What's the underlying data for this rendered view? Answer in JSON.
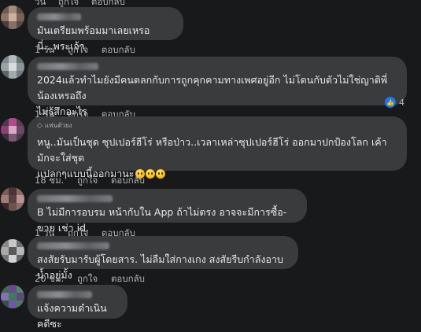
{
  "top_actions": {
    "time": "วัน",
    "like": "ถูกใจ",
    "reply": "ตอบกลับ"
  },
  "comments": [
    {
      "text": "มันเตรียมพร้อมมาเลยเหรอนี่...พระเจ้า",
      "time": "1 วัน",
      "like": "ถูกใจ",
      "reply": "ตอบกลับ"
    },
    {
      "text": "2024แล้วทำไมยังมีคนตลกกับการถูกคุกคามทางเพศอยู่อีก ไม่โดนกับตัวไม่ใช่ญาติพี่น้องเหรอถึง\nไม่รู้สึกอะไร",
      "time": "1 วัน",
      "like": "ถูกใจ",
      "reply": "ตอบกลับ",
      "reaction_count": "4"
    },
    {
      "badge": "แฟนตัวยง",
      "text": "หนู..มันเป็นชุด ซุปเปอร์ฮีโร่ หรือป่าว..เวลาเหล่าซุปเปอร์ฮีโร่ ออกมาปกป้องโลก เค้ามักจะใส่ชุด\nแปลกๆแบบนี้ออกมานะ",
      "time": "18 ชม.",
      "like": "ถูกใจ",
      "reply": "ตอบกลับ"
    },
    {
      "text": "B ไม่มีการอบรม หน้ากับใน App ถ้าไม่ตรง อาจจะมีการซื้อ-ขาย เช่า id.",
      "time": "1 วัน",
      "like": "ถูกใจ",
      "reply": "ตอบกลับ"
    },
    {
      "text": "สงสัยรับมารับผู้โดยสาร. ไม่ลืมใส่กางเกง สงสัยรีบกำลังอาบน้ำอยู่มั้ง",
      "time": "20 ชม.",
      "like": "ถูกใจ",
      "reply": "ตอบกลับ"
    },
    {
      "text": "แจ้งความดำเนินคดีซะ"
    }
  ],
  "colors": {
    "background": "#18191a",
    "bubble": "#3a3b3c",
    "text": "#e4e6eb",
    "meta": "#b0b3b8",
    "like": "#1877f2"
  }
}
